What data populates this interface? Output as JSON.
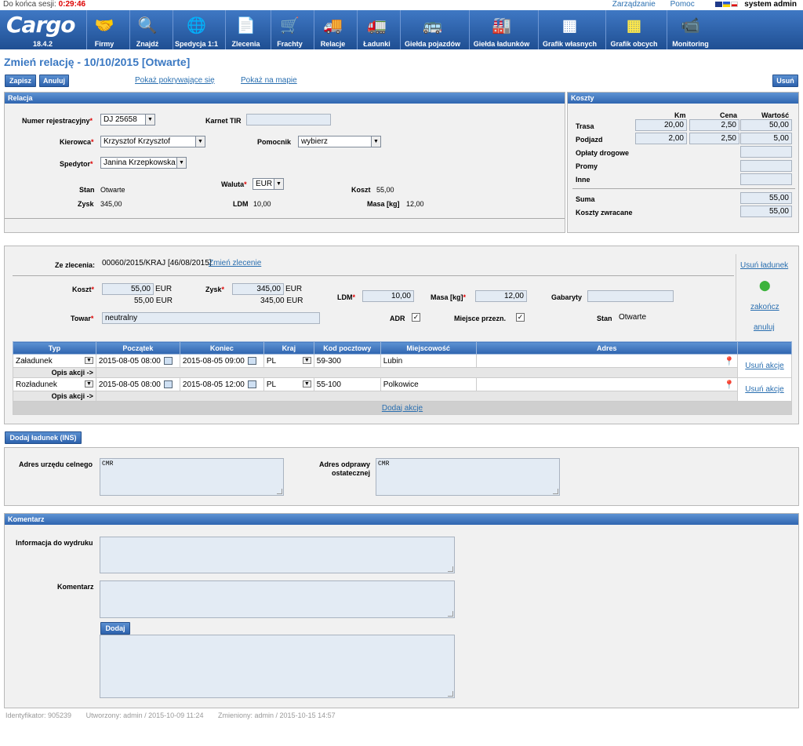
{
  "session": {
    "label": "Do końca sesji:",
    "time": "0:29:46"
  },
  "toplinks": {
    "manage": "Zarządzanie",
    "help": "Pomoc",
    "user": "system admin"
  },
  "nav": {
    "version": "18.4.2",
    "logo": "Cargo",
    "items": [
      {
        "label": "Firmy",
        "icon": "handshake-icon"
      },
      {
        "label": "Znajdź",
        "icon": "search-icon"
      },
      {
        "label": "Spedycja 1:1",
        "icon": "globe-icon"
      },
      {
        "label": "Zlecenia",
        "icon": "document-cart-icon"
      },
      {
        "label": "Frachty",
        "icon": "cart-icon"
      },
      {
        "label": "Relacje",
        "icon": "truck-icon"
      },
      {
        "label": "Ładunki",
        "icon": "cargo-truck-icon"
      },
      {
        "label": "Giełda pojazdów",
        "icon": "vehicle-exchange-icon"
      },
      {
        "label": "Giełda ładunków",
        "icon": "cargo-exchange-icon"
      },
      {
        "label": "Grafik własnych",
        "icon": "schedule-icon"
      },
      {
        "label": "Grafik obcych",
        "icon": "schedule-yellow-icon"
      },
      {
        "label": "Monitoring",
        "icon": "camera-icon"
      }
    ]
  },
  "page": {
    "title": "Zmień relację - 10/10/2015 [Otwarte]"
  },
  "toolbar": {
    "save": "Zapisz",
    "cancel": "Anuluj",
    "show_covering": "Pokaż pokrywające się",
    "show_map": "Pokaż na mapie",
    "delete": "Usuń"
  },
  "relacja": {
    "header": "Relacja",
    "reg_label": "Numer rejestracyjny",
    "reg_value": "DJ 25658",
    "tir_label": "Karnet TIR",
    "tir_value": "",
    "driver_label": "Kierowca",
    "driver_value": "Krzysztof Krzysztof",
    "helper_label": "Pomocnik",
    "helper_value": "wybierz",
    "forwarder_label": "Spedytor",
    "forwarder_value": "Janina Krzepkowska",
    "state_label": "Stan",
    "state_value": "Otwarte",
    "currency_label": "Waluta",
    "currency_value": "EUR",
    "cost_label": "Koszt",
    "cost_value": "55,00",
    "profit_label": "Zysk",
    "profit_value": "345,00",
    "ldm_label": "LDM",
    "ldm_value": "10,00",
    "mass_label": "Masa [kg]",
    "mass_value": "12,00"
  },
  "koszty": {
    "header": "Koszty",
    "col_km": "Km",
    "col_price": "Cena",
    "col_value": "Wartość",
    "rows": [
      {
        "label": "Trasa",
        "km": "20,00",
        "price": "2,50",
        "value": "50,00"
      },
      {
        "label": "Podjazd",
        "km": "2,00",
        "price": "2,50",
        "value": "5,00"
      },
      {
        "label": "Opłaty drogowe",
        "km": "",
        "price": "",
        "value": ""
      },
      {
        "label": "Promy",
        "km": "",
        "price": "",
        "value": ""
      },
      {
        "label": "Inne",
        "km": "",
        "price": "",
        "value": ""
      }
    ],
    "sum_label": "Suma",
    "sum_value": "55,00",
    "return_label": "Koszty zwracane",
    "return_value": "55,00"
  },
  "ladunek": {
    "order_label": "Ze zlecenia:",
    "order_value": "00060/2015/KRAJ [46/08/2015]",
    "order_change": "Zmień zlecenie",
    "remove": "Usuń ładunek",
    "finish": "zakończ",
    "cancel": "anuluj",
    "cost_label": "Koszt",
    "cost_value": "55,00",
    "cost_cur": "EUR",
    "cost_sub": "55,00 EUR",
    "profit_label": "Zysk",
    "profit_value": "345,00",
    "profit_cur": "EUR",
    "profit_sub": "345,00 EUR",
    "ldm_label": "LDM",
    "ldm_value": "10,00",
    "mass_label": "Masa [kg]",
    "mass_value": "12,00",
    "size_label": "Gabaryty",
    "size_value": "",
    "goods_label": "Towar",
    "goods_value": "neutralny",
    "adr_label": "ADR",
    "adr_checked": "✓",
    "place_label": "Miejsce przezn.",
    "place_checked": "✓",
    "state_label": "Stan",
    "state_value": "Otwarte"
  },
  "actions": {
    "headers": [
      "Typ",
      "Początek",
      "Koniec",
      "Kraj",
      "Kod pocztowy",
      "Miejscowość",
      "Adres",
      ""
    ],
    "rows": [
      {
        "type": "Załadunek",
        "start": "2015-08-05 08:00",
        "end": "2015-08-05 09:00",
        "country": "PL",
        "zip": "59-300",
        "city": "Lubin",
        "address": "",
        "remove": "Usuń akcje",
        "desc": "Opis akcji ->"
      },
      {
        "type": "Rozładunek",
        "start": "2015-08-05 08:00",
        "end": "2015-08-05 12:00",
        "country": "PL",
        "zip": "55-100",
        "city": "Polkowice",
        "address": "",
        "remove": "Usuń akcje",
        "desc": "Opis akcji ->"
      }
    ],
    "add": "Dodaj akcje"
  },
  "add_cargo": "Dodaj ładunek (INS)",
  "customs": {
    "office_label": "Adres urzędu celnego",
    "office_value": "CMR",
    "final_label": "Adres odprawy ostatecznej",
    "final_value": "CMR"
  },
  "komentarz": {
    "header": "Komentarz",
    "print_label": "Informacja do wydruku",
    "comment_label": "Komentarz",
    "add": "Dodaj"
  },
  "footer": {
    "id": "Identyfikator: 905239",
    "created": "Utworzony: admin / 2015-10-09 11:24",
    "modified": "Zmieniony: admin / 2015-10-15 14:57"
  }
}
